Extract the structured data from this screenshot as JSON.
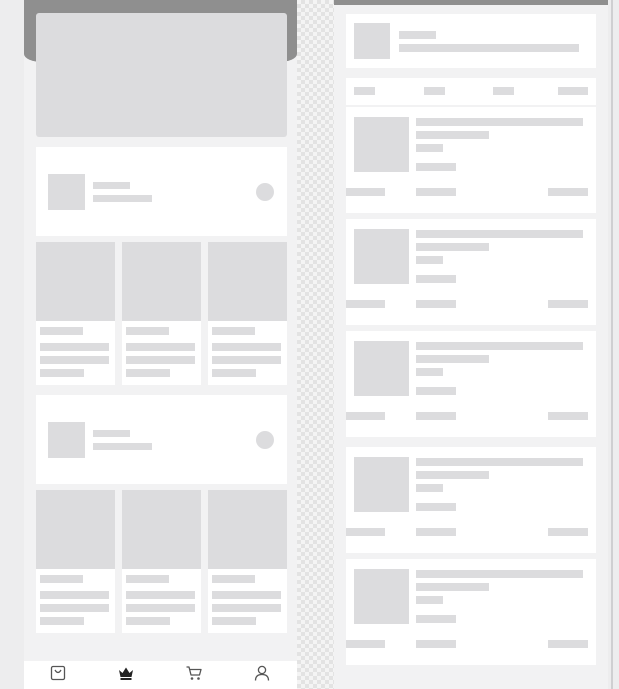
{
  "window": {
    "title": ""
  },
  "colors": {
    "placeholder": "#dcdcde",
    "card": "#ffffff",
    "page_bg": "#f2f2f3",
    "header_bg": "#8f8f8f",
    "active_tab": "#333333",
    "inactive_tab": "#9a9a9a"
  },
  "left_screen": {
    "header_banner": {
      "kind": "image-placeholder"
    },
    "sections": [
      {
        "kind": "brand-section",
        "products": 3
      },
      {
        "kind": "brand-section",
        "products": 3
      }
    ],
    "tabbar": {
      "active_index": 1,
      "tabs": [
        {
          "icon": "bag-icon",
          "label": ""
        },
        {
          "icon": "crown-icon",
          "label": ""
        },
        {
          "icon": "cart-icon",
          "label": ""
        },
        {
          "icon": "user-icon",
          "label": ""
        }
      ]
    }
  },
  "right_screen": {
    "tabs": 4,
    "list_items": 5
  }
}
